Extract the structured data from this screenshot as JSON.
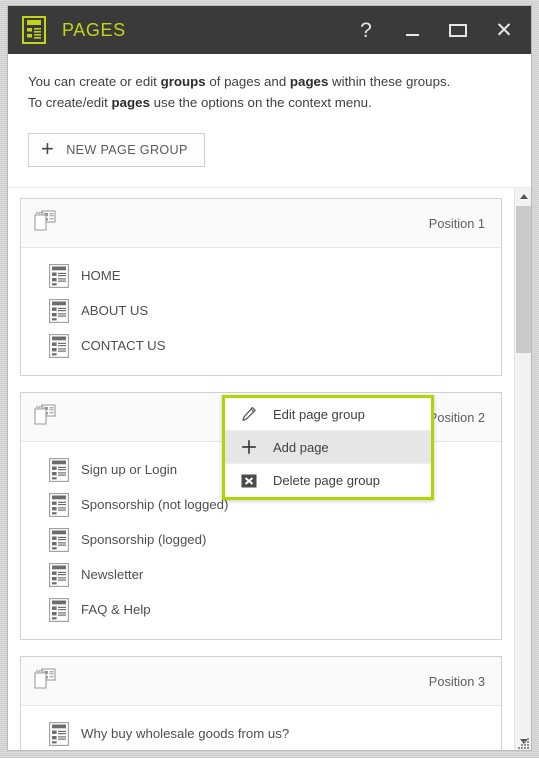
{
  "window": {
    "title": "PAGES",
    "icon": "page-document-icon",
    "accent_color": "#c3d418",
    "titlebar_bg": "#3a3a3a",
    "buttons": {
      "help": "?",
      "minimize": "_",
      "maximize": "□",
      "close": "✕"
    }
  },
  "description": {
    "line1_prefix": "You can create or edit ",
    "line1_bold1": "groups",
    "line1_mid": " of pages and ",
    "line1_bold2": "pages",
    "line1_suffix": " within these groups.",
    "line2_prefix": "To create/edit ",
    "line2_bold1": "pages",
    "line2_suffix": " use the options on the context menu."
  },
  "toolbar": {
    "new_page_group_label": "NEW PAGE GROUP",
    "new_page_group_icon": "plus-icon"
  },
  "context_menu": {
    "highlight_color": "#b3d404",
    "items": [
      {
        "label": "Edit page group",
        "icon": "pencil-icon",
        "hovered": false
      },
      {
        "label": "Add page",
        "icon": "plus-icon",
        "hovered": true
      },
      {
        "label": "Delete page group",
        "icon": "delete-x-box-icon",
        "hovered": false
      }
    ]
  },
  "groups": [
    {
      "position_label": "Position 1",
      "folder_icon": "page-group-folder-icon",
      "pages": [
        {
          "label": "HOME",
          "icon": "page-icon"
        },
        {
          "label": "ABOUT US",
          "icon": "page-icon"
        },
        {
          "label": "CONTACT US",
          "icon": "page-icon"
        }
      ]
    },
    {
      "position_label": "Position 2",
      "folder_icon": "page-group-folder-icon",
      "pages": [
        {
          "label": "Sign up or Login",
          "icon": "page-icon"
        },
        {
          "label": "Sponsorship (not logged)",
          "icon": "page-icon"
        },
        {
          "label": "Sponsorship (logged)",
          "icon": "page-icon"
        },
        {
          "label": "Newsletter",
          "icon": "page-icon"
        },
        {
          "label": "FAQ & Help",
          "icon": "page-icon"
        }
      ]
    },
    {
      "position_label": "Position 3",
      "folder_icon": "page-group-folder-icon",
      "pages": [
        {
          "label": "Why buy wholesale goods from us?",
          "icon": "page-icon"
        }
      ]
    }
  ],
  "scrollbar": {
    "up_arrow": "chevron-up-icon",
    "down_arrow": "chevron-down-icon",
    "thumb": "scrollbar-thumb"
  }
}
